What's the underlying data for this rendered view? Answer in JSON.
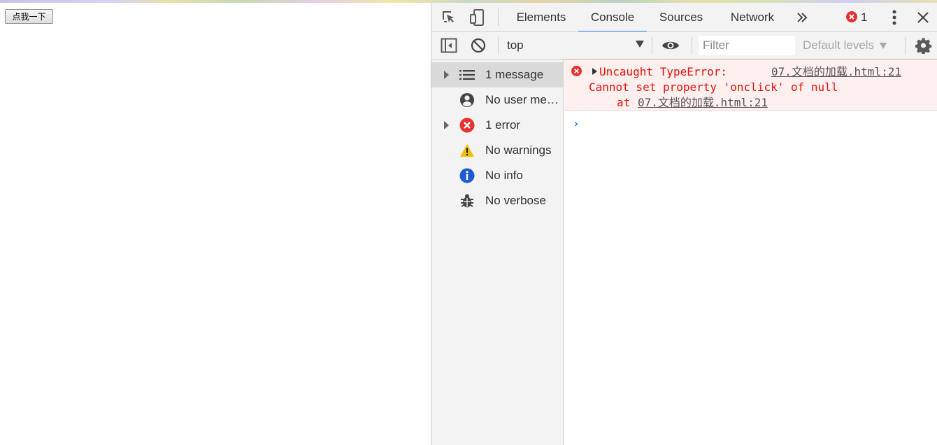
{
  "page": {
    "button_label": "点我一下"
  },
  "devtools": {
    "tabs": [
      {
        "label": "Elements"
      },
      {
        "label": "Console"
      },
      {
        "label": "Sources"
      },
      {
        "label": "Network"
      }
    ],
    "error_count": "1",
    "toolbar": {
      "context": "top",
      "filter_placeholder": "Filter",
      "levels": "Default levels"
    },
    "sidebar": {
      "items": [
        {
          "label": "1 message"
        },
        {
          "label": "No user messages"
        },
        {
          "label": "1 error"
        },
        {
          "label": "No warnings"
        },
        {
          "label": "No info"
        },
        {
          "label": "No verbose"
        }
      ]
    },
    "console": {
      "error": {
        "title": "Uncaught TypeError:",
        "source_link": "07.文档的加载.html:21",
        "message": "Cannot set property 'onclick' of null",
        "at_prefix": "at ",
        "stack_link": "07.文档的加载.html:21"
      },
      "prompt": "›"
    },
    "colors": {
      "accent": "#1a73e8",
      "error": "#e8120b",
      "error_bg": "#fdf0ef"
    }
  }
}
